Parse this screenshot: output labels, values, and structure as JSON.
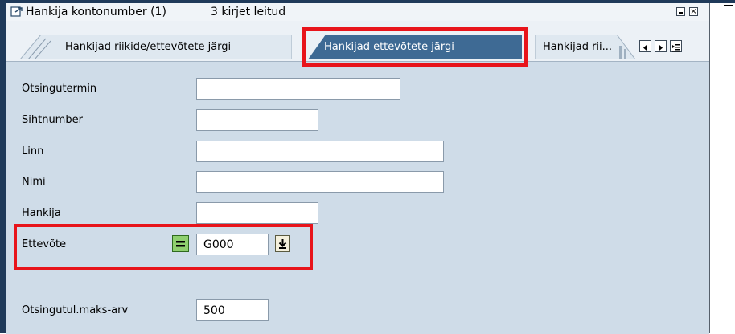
{
  "window": {
    "title": "Hankija kontonumber (1)",
    "status": "3 kirjet leitud"
  },
  "tabs": [
    {
      "label": "Hankijad riikide/ettevõtete järgi",
      "active": false
    },
    {
      "label": "Hankijad ettevõtete järgi",
      "active": true
    },
    {
      "label": "Hankijad rii...",
      "active": false
    }
  ],
  "form": {
    "search_term_label": "Otsingutermin",
    "search_term_value": "",
    "postcode_label": "Sihtnumber",
    "postcode_value": "",
    "city_label": "Linn",
    "city_value": "",
    "name_label": "Nimi",
    "name_value": "",
    "vendor_label": "Hankija",
    "vendor_value": "",
    "company_label": "Ettevõte",
    "company_value": "G000",
    "max_hits_label": "Otsingutul.maks-arv",
    "max_hits_value": "500"
  },
  "colors": {
    "highlight": "#e8141b",
    "active_tab": "#3e6a94",
    "content_bg": "#cfdce8"
  }
}
